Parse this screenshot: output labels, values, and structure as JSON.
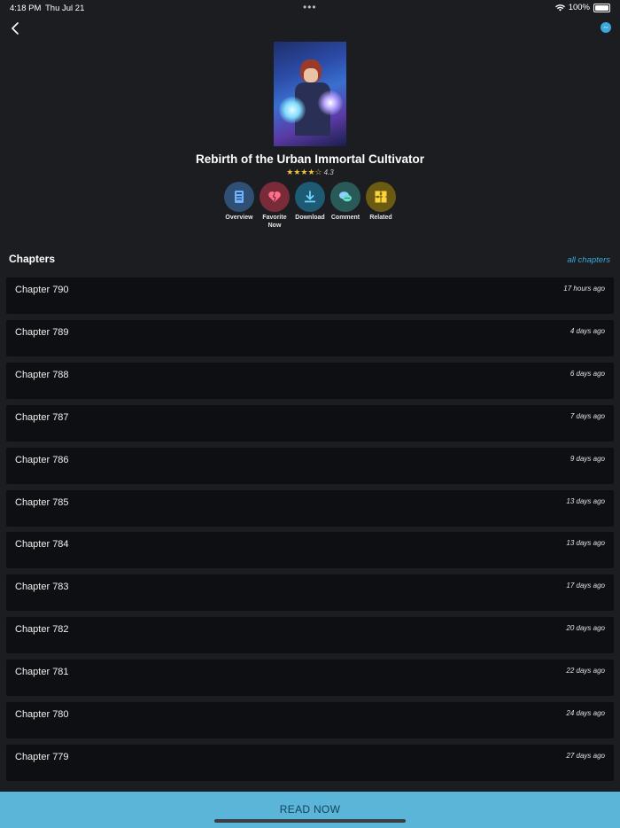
{
  "status_bar": {
    "time": "4:18 PM",
    "date": "Thu Jul 21",
    "battery": "100%"
  },
  "book": {
    "title": "Rebirth of the Urban Immortal Cultivator",
    "stars": "★★★★☆",
    "rating": "4.3"
  },
  "actions": [
    {
      "label": "Overview",
      "color": "#2f4f75",
      "icon": "overview-icon"
    },
    {
      "label": "Favorite Now",
      "color": "#7a2b3a",
      "icon": "heart-icon"
    },
    {
      "label": "Download",
      "color": "#1d5a73",
      "icon": "download-icon"
    },
    {
      "label": "Comment",
      "color": "#2a5a58",
      "icon": "comment-icon"
    },
    {
      "label": "Related",
      "color": "#6b5a12",
      "icon": "puzzle-icon"
    }
  ],
  "chapters_header": "Chapters",
  "all_chapters_link": "all chapters",
  "chapters": [
    {
      "name": "Chapter 790",
      "time": "17 hours ago"
    },
    {
      "name": "Chapter 789",
      "time": "4 days ago"
    },
    {
      "name": "Chapter 788",
      "time": "6 days ago"
    },
    {
      "name": "Chapter 787",
      "time": "7 days ago"
    },
    {
      "name": "Chapter 786",
      "time": "9 days ago"
    },
    {
      "name": "Chapter 785",
      "time": "13 days ago"
    },
    {
      "name": "Chapter 784",
      "time": "13 days ago"
    },
    {
      "name": "Chapter 783",
      "time": "17 days ago"
    },
    {
      "name": "Chapter 782",
      "time": "20 days ago"
    },
    {
      "name": "Chapter 781",
      "time": "22 days ago"
    },
    {
      "name": "Chapter 780",
      "time": "24 days ago"
    },
    {
      "name": "Chapter 779",
      "time": "27 days ago"
    }
  ],
  "read_now": "READ NOW"
}
